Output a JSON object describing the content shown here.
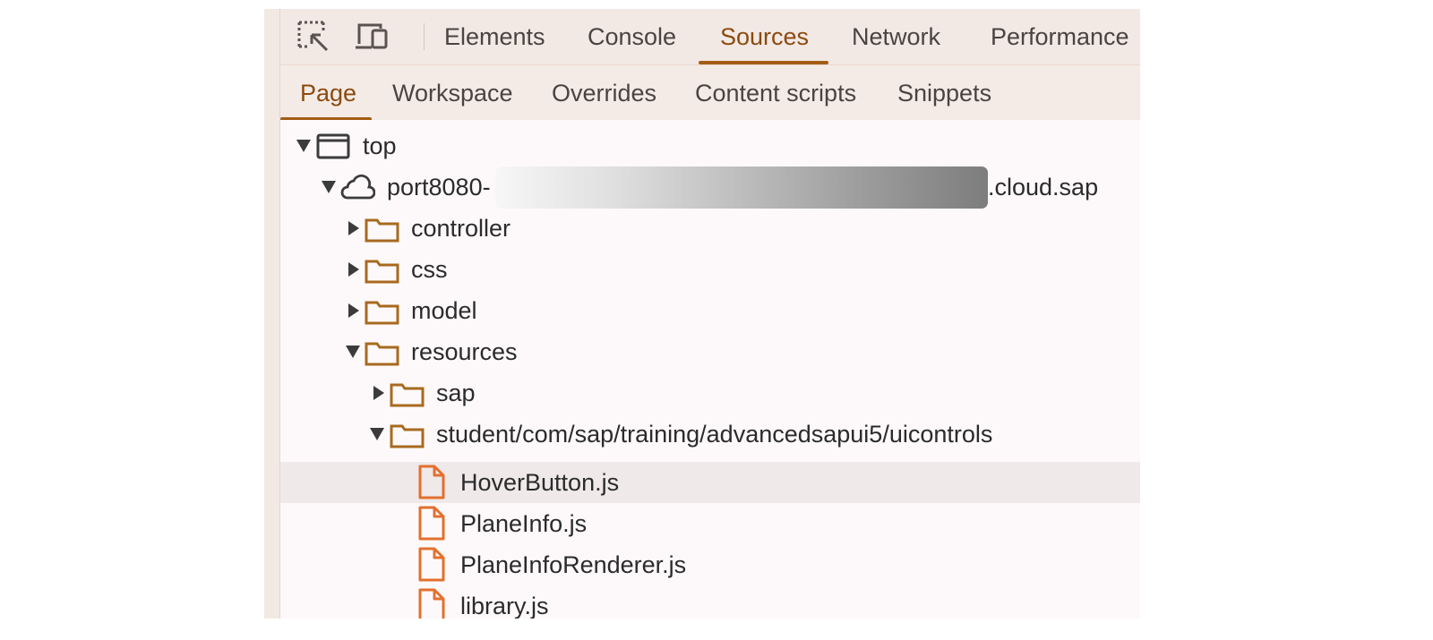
{
  "main_tabs": [
    {
      "label": "Elements",
      "active": false
    },
    {
      "label": "Console",
      "active": false
    },
    {
      "label": "Sources",
      "active": true
    },
    {
      "label": "Network",
      "active": false
    },
    {
      "label": "Performance",
      "active": false
    }
  ],
  "toolbar_icons": [
    "inspect-element-icon",
    "device-toolbar-icon"
  ],
  "sub_tabs": [
    {
      "label": "Page",
      "active": true
    },
    {
      "label": "Workspace",
      "active": false
    },
    {
      "label": "Overrides",
      "active": false
    },
    {
      "label": "Content scripts",
      "active": false
    },
    {
      "label": "Snippets",
      "active": false
    }
  ],
  "tree": [
    {
      "label": "top",
      "icon": "frame-icon",
      "expanded": true,
      "depth": 0
    },
    {
      "label_prefix": "port8080-",
      "label_suffix": ".cloud.sap",
      "icon": "cloud-icon",
      "expanded": true,
      "depth": 1,
      "redacted": true
    },
    {
      "label": "controller",
      "icon": "folder-icon",
      "expanded": false,
      "depth": 2
    },
    {
      "label": "css",
      "icon": "folder-icon",
      "expanded": false,
      "depth": 2
    },
    {
      "label": "model",
      "icon": "folder-icon",
      "expanded": false,
      "depth": 2
    },
    {
      "label": "resources",
      "icon": "folder-icon",
      "expanded": true,
      "depth": 2
    },
    {
      "label": "sap",
      "icon": "folder-icon",
      "expanded": false,
      "depth": 3
    },
    {
      "label": "student/com/sap/training/advancedsapui5/uicontrols",
      "icon": "folder-icon",
      "expanded": true,
      "depth": 3
    },
    {
      "label": "HoverButton.js",
      "icon": "file-icon",
      "depth": 4,
      "selected": true
    },
    {
      "label": "PlaneInfo.js",
      "icon": "file-icon",
      "depth": 4
    },
    {
      "label": "PlaneInfoRenderer.js",
      "icon": "file-icon",
      "depth": 4
    },
    {
      "label": "library.js",
      "icon": "file-icon",
      "depth": 4
    }
  ],
  "colors": {
    "accent": "#a35c16",
    "folder": "#a86a1f",
    "file": "#e3702f"
  }
}
